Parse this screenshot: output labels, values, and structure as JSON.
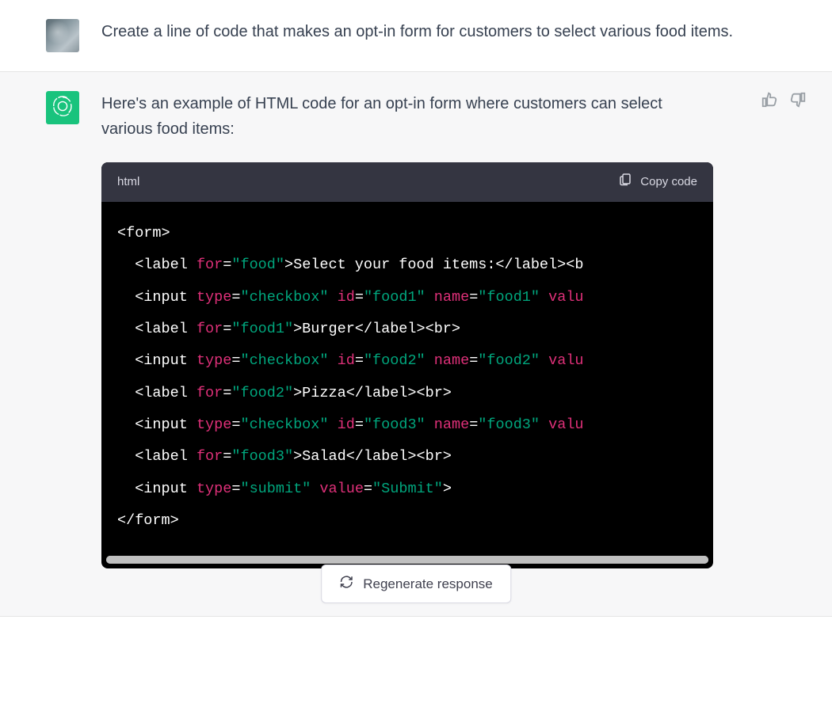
{
  "user": {
    "prompt": "Create a line of code that makes an opt-in form for customers to select various food items."
  },
  "assistant": {
    "intro": "Here's an example of HTML code for an opt-in form where customers can select various food items:",
    "code": {
      "lang_label": "html",
      "copy_label": "Copy code",
      "tokens": {
        "l1_open": "<form>",
        "l2_tag_open": "<label",
        "l2_attr": "for",
        "l2_val": "\"food\"",
        "l2_rest": ">Select your food items:</label><b",
        "l3_tag_open": "<input",
        "l3_a1": "type",
        "l3_v1": "\"checkbox\"",
        "l3_a2": "id",
        "l3_v2": "\"food1\"",
        "l3_a3": "name",
        "l3_v3": "\"food1\"",
        "l3_a4": "valu",
        "l4_tag_open": "<label",
        "l4_attr": "for",
        "l4_val": "\"food1\"",
        "l4_rest": ">Burger</label><br>",
        "l5_tag_open": "<input",
        "l5_a1": "type",
        "l5_v1": "\"checkbox\"",
        "l5_a2": "id",
        "l5_v2": "\"food2\"",
        "l5_a3": "name",
        "l5_v3": "\"food2\"",
        "l5_a4": "valu",
        "l6_tag_open": "<label",
        "l6_attr": "for",
        "l6_val": "\"food2\"",
        "l6_rest": ">Pizza</label><br>",
        "l7_tag_open": "<input",
        "l7_a1": "type",
        "l7_v1": "\"checkbox\"",
        "l7_a2": "id",
        "l7_v2": "\"food3\"",
        "l7_a3": "name",
        "l7_v3": "\"food3\"",
        "l7_a4": "valu",
        "l8_tag_open": "<label",
        "l8_attr": "for",
        "l8_val": "\"food3\"",
        "l8_rest": ">Salad</label><br>",
        "l9_tag_open": "<input",
        "l9_a1": "type",
        "l9_v1": "\"submit\"",
        "l9_a2": "value",
        "l9_v2": "\"Submit\"",
        "l9_close": ">",
        "l10_close": "</form>"
      }
    }
  },
  "actions": {
    "regenerate_label": "Regenerate response"
  },
  "icons": {
    "thumbs_up": "thumbs-up-icon",
    "thumbs_down": "thumbs-down-icon",
    "clipboard": "clipboard-icon",
    "refresh": "refresh-icon",
    "openai": "openai-logo-icon"
  }
}
